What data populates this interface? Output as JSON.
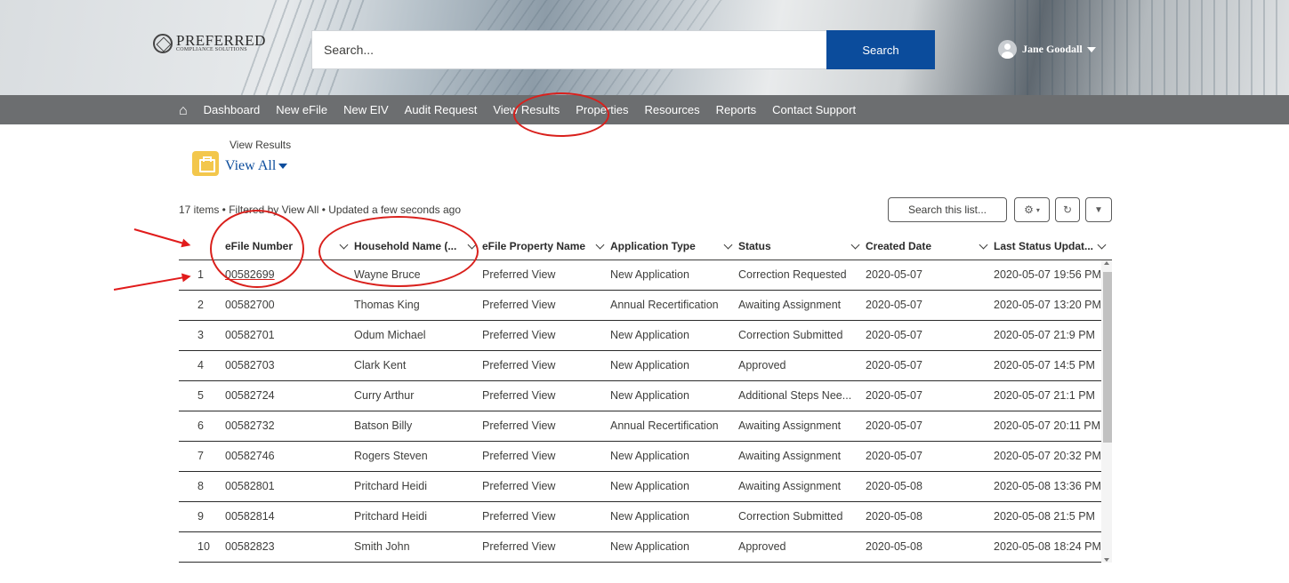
{
  "header": {
    "logo_text": "PREFERRED",
    "logo_subtext": "COMPLIANCE SOLUTIONS",
    "search_placeholder": "Search...",
    "search_button": "Search",
    "user_name": "Jane Goodall"
  },
  "nav": {
    "items": [
      "Dashboard",
      "New eFile",
      "New EIV",
      "Audit Request",
      "View Results",
      "Properties",
      "Resources",
      "Reports",
      "Contact Support"
    ]
  },
  "page": {
    "object_label": "View Results",
    "list_view": "View All",
    "meta": "17 items • Filtered by View All • Updated a few seconds ago",
    "search_list_placeholder": "Search this list..."
  },
  "table": {
    "columns": [
      "eFile Number",
      "Household Name (...",
      "eFile Property Name",
      "Application Type",
      "Status",
      "Created Date",
      "Last Status Updat..."
    ],
    "rows": [
      [
        "1",
        "00582699",
        "Wayne Bruce",
        "Preferred View",
        "New Application",
        "Correction Requested",
        "2020-05-07",
        "2020-05-07 19:56 PM"
      ],
      [
        "2",
        "00582700",
        "Thomas King",
        "Preferred View",
        "Annual Recertification",
        "Awaiting Assignment",
        "2020-05-07",
        "2020-05-07 13:20 PM"
      ],
      [
        "3",
        "00582701",
        "Odum Michael",
        "Preferred View",
        "New Application",
        "Correction Submitted",
        "2020-05-07",
        "2020-05-07 21:9 PM"
      ],
      [
        "4",
        "00582703",
        "Clark Kent",
        "Preferred View",
        "New Application",
        "Approved",
        "2020-05-07",
        "2020-05-07 14:5 PM"
      ],
      [
        "5",
        "00582724",
        "Curry Arthur",
        "Preferred View",
        "New Application",
        "Additional Steps Nee...",
        "2020-05-07",
        "2020-05-07 21:1 PM"
      ],
      [
        "6",
        "00582732",
        "Batson Billy",
        "Preferred View",
        "Annual Recertification",
        "Awaiting Assignment",
        "2020-05-07",
        "2020-05-07 20:11 PM"
      ],
      [
        "7",
        "00582746",
        "Rogers Steven",
        "Preferred View",
        "New Application",
        "Awaiting Assignment",
        "2020-05-07",
        "2020-05-07 20:32 PM"
      ],
      [
        "8",
        "00582801",
        "Pritchard Heidi",
        "Preferred View",
        "New Application",
        "Awaiting Assignment",
        "2020-05-08",
        "2020-05-08 13:36 PM"
      ],
      [
        "9",
        "00582814",
        "Pritchard Heidi",
        "Preferred View",
        "New Application",
        "Correction Submitted",
        "2020-05-08",
        "2020-05-08 21:5 PM"
      ],
      [
        "10",
        "00582823",
        "Smith John",
        "Preferred View",
        "New Application",
        "Approved",
        "2020-05-08",
        "2020-05-08 18:24 PM"
      ]
    ]
  },
  "colors": {
    "brand_blue": "#0b4c9c",
    "nav_bg": "#5f6264",
    "annotation_red": "#d9201c"
  }
}
